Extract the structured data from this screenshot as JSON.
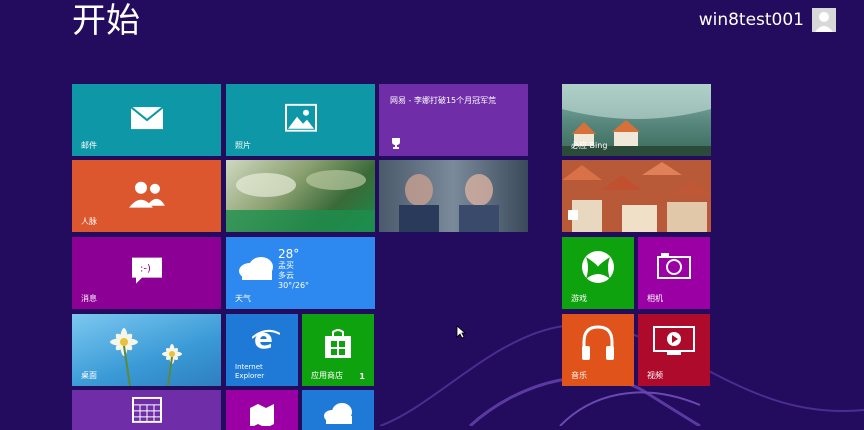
{
  "header": {
    "title": "开始",
    "username": "win8test001"
  },
  "tiles": {
    "mail": {
      "label": "邮件",
      "icon": "mail-icon",
      "color": "#0e98a7"
    },
    "photos": {
      "label": "照片",
      "icon": "photo-icon",
      "color": "#0e98a7"
    },
    "news": {
      "headline": "网易 - 李娜打破15个月冠军荒",
      "icon": "trophy-icon",
      "color": "#6f2ea8"
    },
    "bing": {
      "label": "必应 Bing",
      "color": "#3a8a7e"
    },
    "people": {
      "label": "人脉",
      "icon": "people-icon",
      "color": "#dc572e"
    },
    "messaging": {
      "label": "消息",
      "icon": "chat-icon",
      "color": "#8c0095"
    },
    "weather": {
      "label": "天气",
      "temp": "28°",
      "city": "孟买",
      "condition": "多云",
      "range": "30°/26°",
      "icon": "cloud-icon",
      "color": "#2d89ef"
    },
    "desktop": {
      "label": "桌面",
      "color": "#4aa8e0"
    },
    "ie": {
      "label": "Internet\nExplorer",
      "icon": "ie-icon",
      "color": "#1e7ad6"
    },
    "store": {
      "label": "应用商店",
      "badge": "1",
      "icon": "store-icon",
      "color": "#0ea30e"
    },
    "games": {
      "label": "游戏",
      "icon": "xbox-icon",
      "color": "#0ea30e"
    },
    "camera": {
      "label": "相机",
      "icon": "camera-icon",
      "color": "#9b00a4"
    },
    "music": {
      "label": "音乐",
      "icon": "headphones-icon",
      "color": "#e0541c"
    },
    "video": {
      "label": "视频",
      "icon": "video-icon",
      "color": "#ae0a2c"
    },
    "calendar": {
      "icon": "calendar-icon",
      "color": "#6f2ea8"
    },
    "maps": {
      "icon": "maps-icon",
      "color": "#9b00a4"
    },
    "skydrive": {
      "icon": "skydrive-icon",
      "color": "#1e7ad6"
    }
  }
}
